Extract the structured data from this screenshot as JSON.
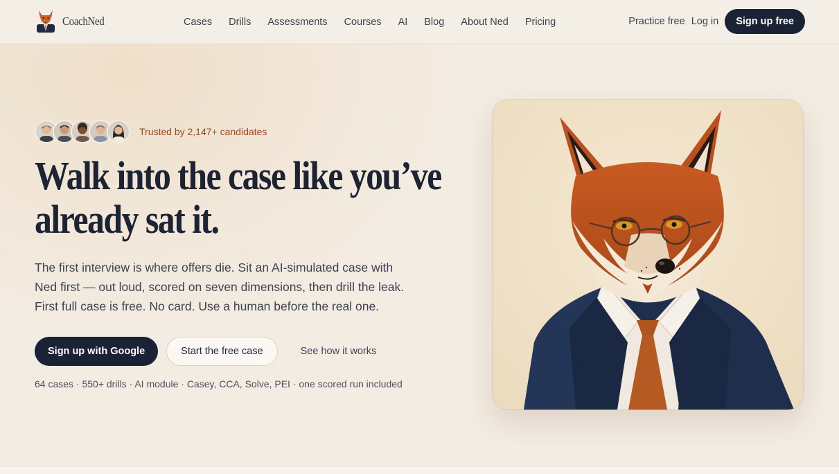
{
  "brand": {
    "name": "CoachNed",
    "logo_icon": "fox-logo-icon"
  },
  "nav": {
    "items": [
      {
        "label": "Cases"
      },
      {
        "label": "Drills"
      },
      {
        "label": "Assessments"
      },
      {
        "label": "Courses"
      },
      {
        "label": "AI"
      },
      {
        "label": "Blog"
      },
      {
        "label": "About Ned"
      },
      {
        "label": "Pricing"
      }
    ]
  },
  "header_actions": {
    "practice_label": "Practice free",
    "login_label": "Log in",
    "signup_label": "Sign up free"
  },
  "hero": {
    "trust_text": "Trusted by 2,147+ candidates",
    "headline_line1": "Walk into the case like you’ve",
    "headline_line2": "already sat it.",
    "subtext_line1": "The first interview is where offers die. Sit an AI-simulated case with",
    "subtext_line2": "Ned first — out loud, scored on seven dimensions, then drill the leak.",
    "subtext_line3": "First full case is free. No card. Use a human before the real one.",
    "cta_google": "Sign up with Google",
    "cta_free_case": "Start the free case",
    "cta_how": "See how it works",
    "stats": "64 cases · 550+ drills · AI module · Casey, CCA, Solve, PEI · one scored run included",
    "illustration_icon": "fox-in-suit-illustration"
  },
  "colors": {
    "primary_dark": "#1a2236",
    "accent_rust": "#9a4a1c",
    "background": "#f3ece2"
  }
}
